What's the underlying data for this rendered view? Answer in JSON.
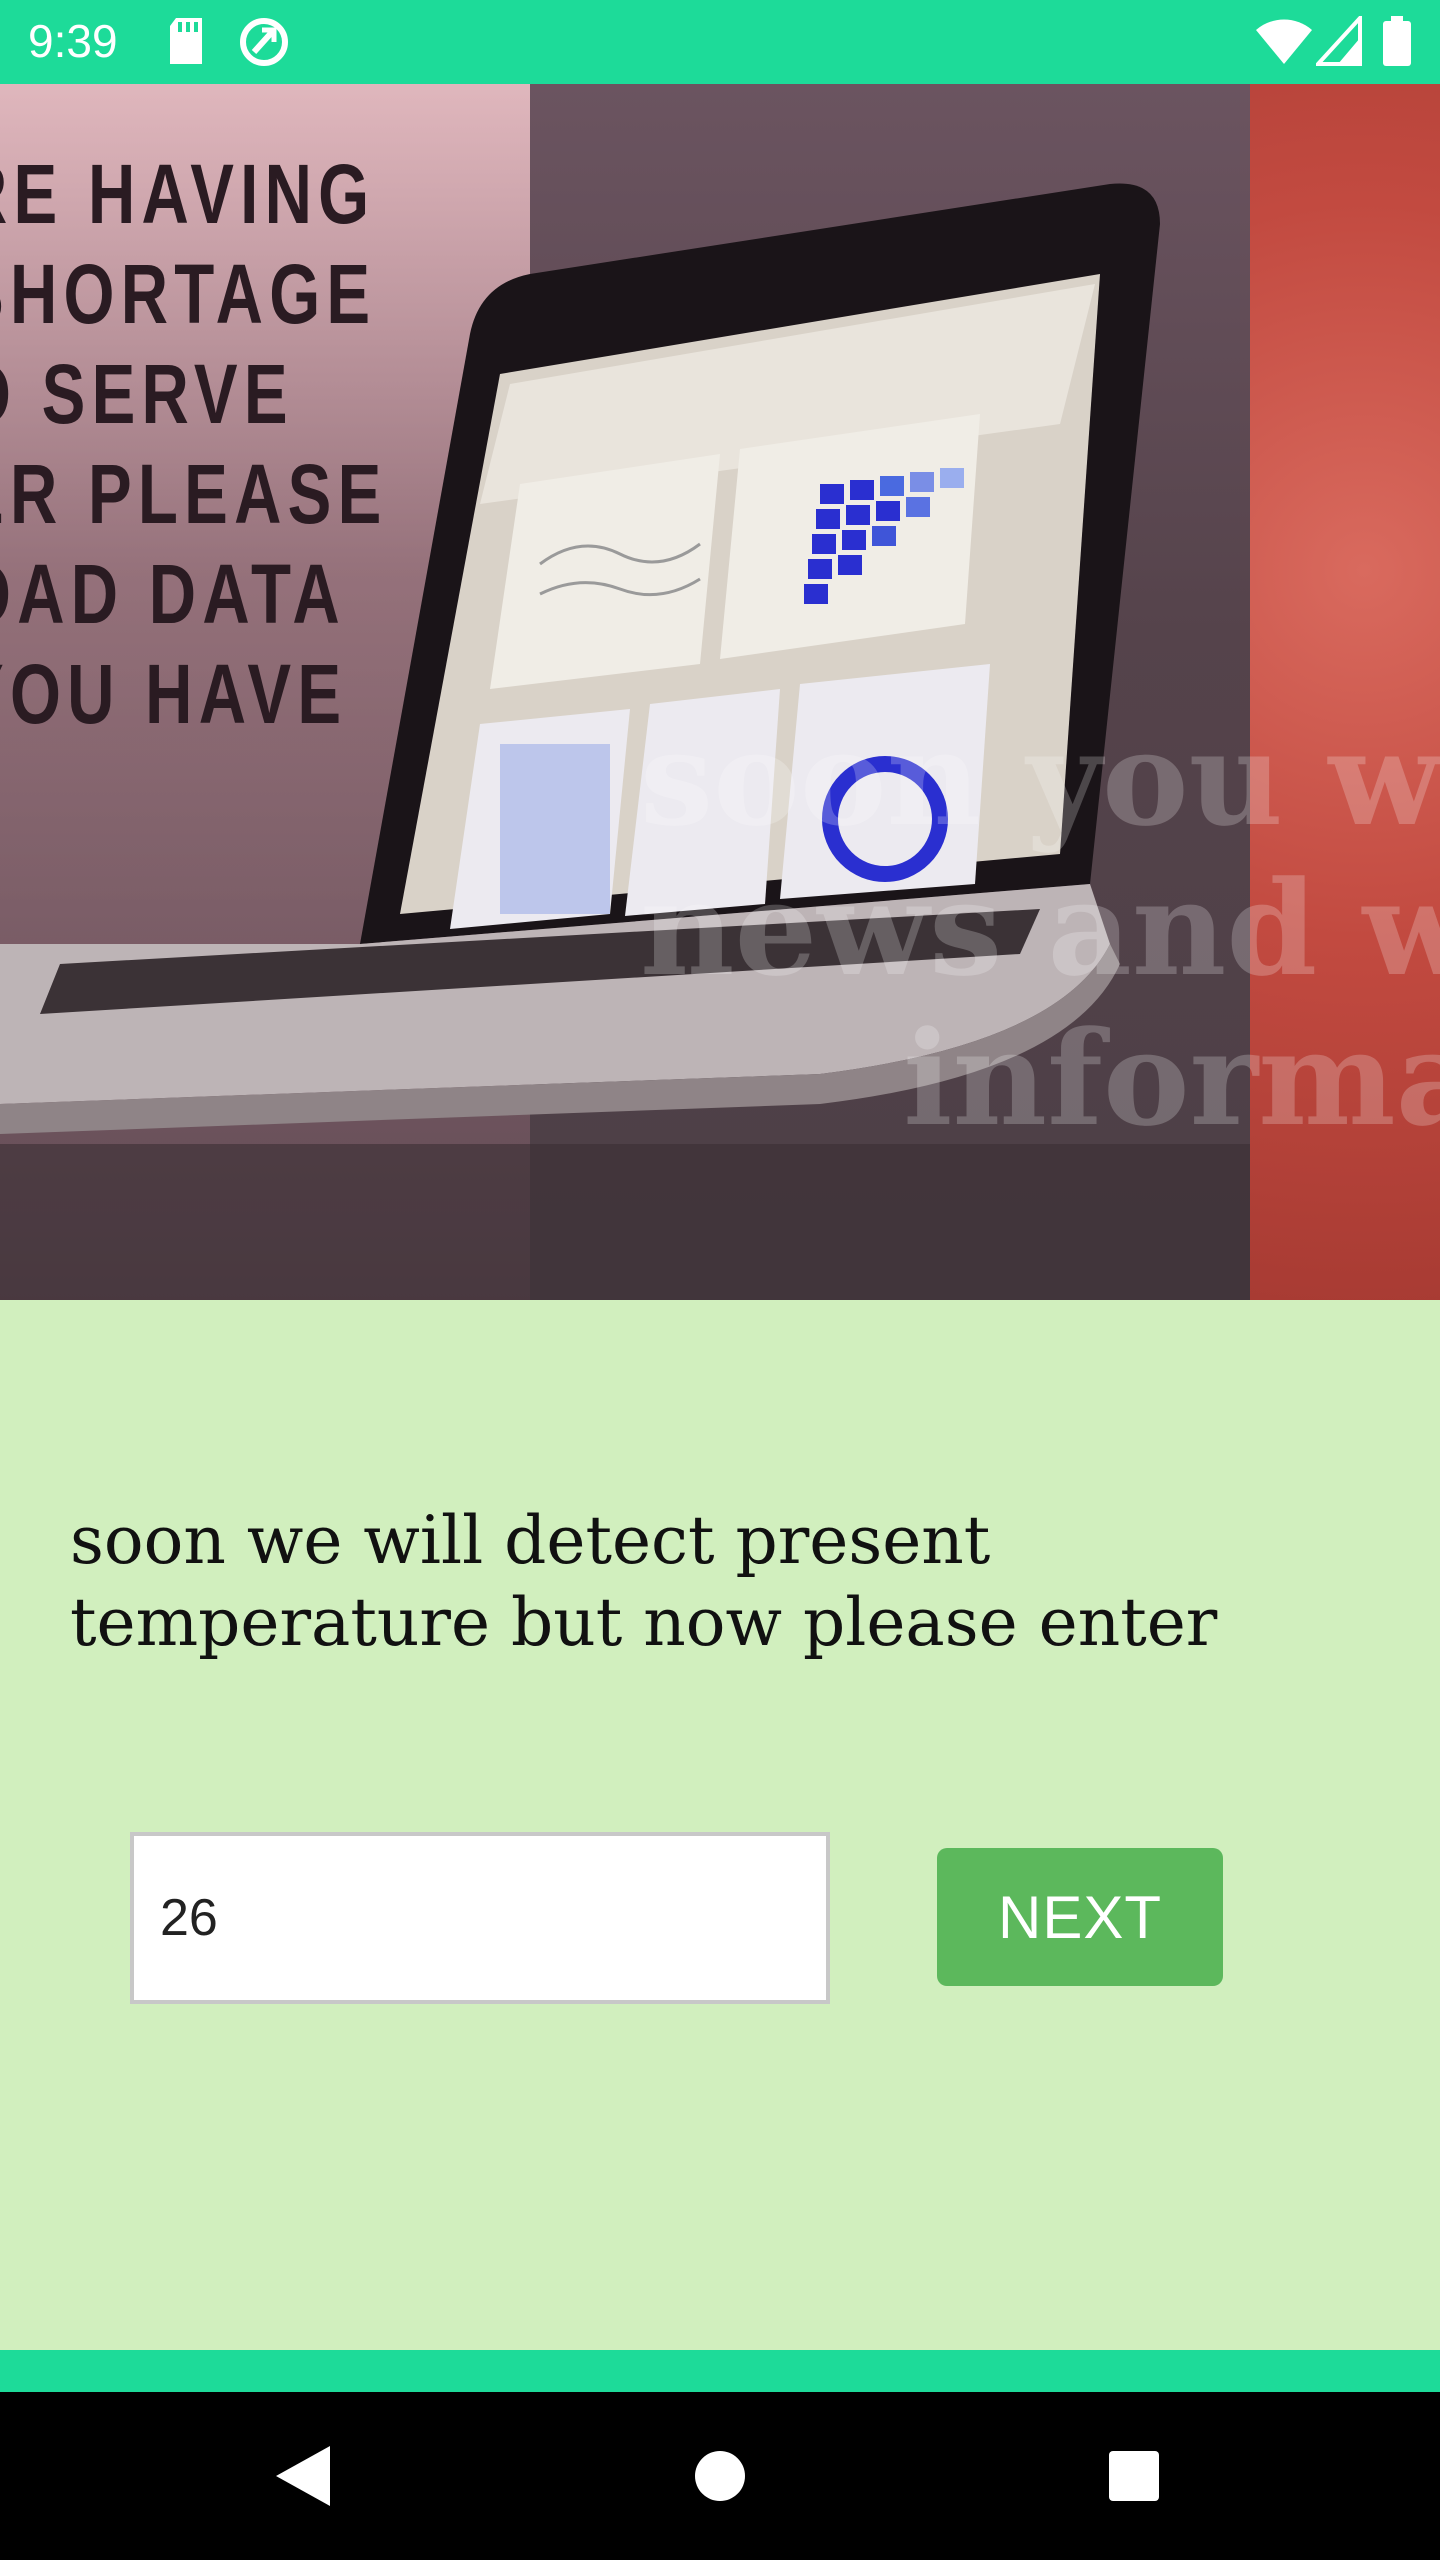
{
  "status_bar": {
    "time": "9:39",
    "icons": [
      "sd-card-icon",
      "sync-icon",
      "wifi-icon",
      "signal-icon",
      "battery-icon"
    ],
    "color": "#1ddb99"
  },
  "banner": {
    "poster_lines": [
      "RE HAVING",
      "SHORTAGE",
      "O SERVE",
      "ER PLEASE",
      "OAD DATA",
      "YOU HAVE"
    ],
    "overlay_lines": [
      "soon you will",
      "news and we",
      "informat"
    ]
  },
  "main": {
    "prompt": "soon we will detect present temperature but now please enter",
    "temperature_input": {
      "value": "26"
    },
    "next_label": "NEXT",
    "background": "#d1efbe",
    "button_color": "#5cb85c"
  },
  "nav": {
    "icons": [
      "back-icon",
      "home-icon",
      "recents-icon"
    ]
  }
}
